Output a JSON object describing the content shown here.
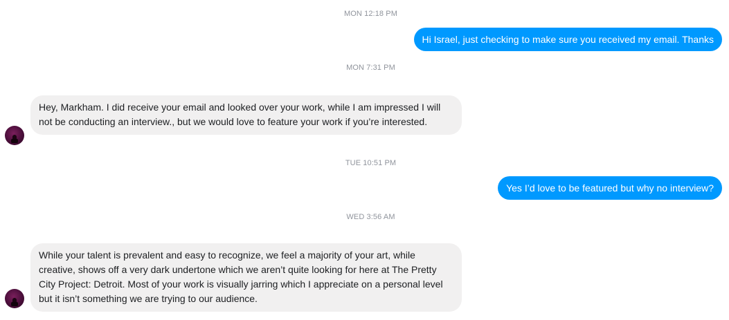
{
  "conversation": {
    "timestamps": [
      "MON 12:18 PM",
      "MON 7:31 PM",
      "TUE 10:51 PM",
      "WED 3:56 AM"
    ],
    "messages": [
      {
        "direction": "outgoing",
        "text": "Hi Israel, just checking to make sure you received my email. Thanks"
      },
      {
        "direction": "incoming",
        "text": "Hey, Markham. I did receive your email and looked over your work, while I am impressed I will not be conducting an interview., but we would love to feature your work if you’re interested."
      },
      {
        "direction": "outgoing",
        "text": "Yes I’d love to be featured but why no interview?"
      },
      {
        "direction": "incoming",
        "text": "While your talent is prevalent and easy to recognize, we feel a majority of your art, while creative, shows off a very dark undertone which we aren’t quite looking for here at The Pretty City Project: Detroit. Most of your work is visually jarring which I appreciate on a personal level but it isn’t something we are trying to our audience."
      }
    ]
  },
  "colors": {
    "outgoing_bubble": "#0099ff",
    "incoming_bubble": "#f1f0f0",
    "timestamp_text": "#90949c"
  },
  "icons": {
    "avatar": "contact-avatar"
  }
}
